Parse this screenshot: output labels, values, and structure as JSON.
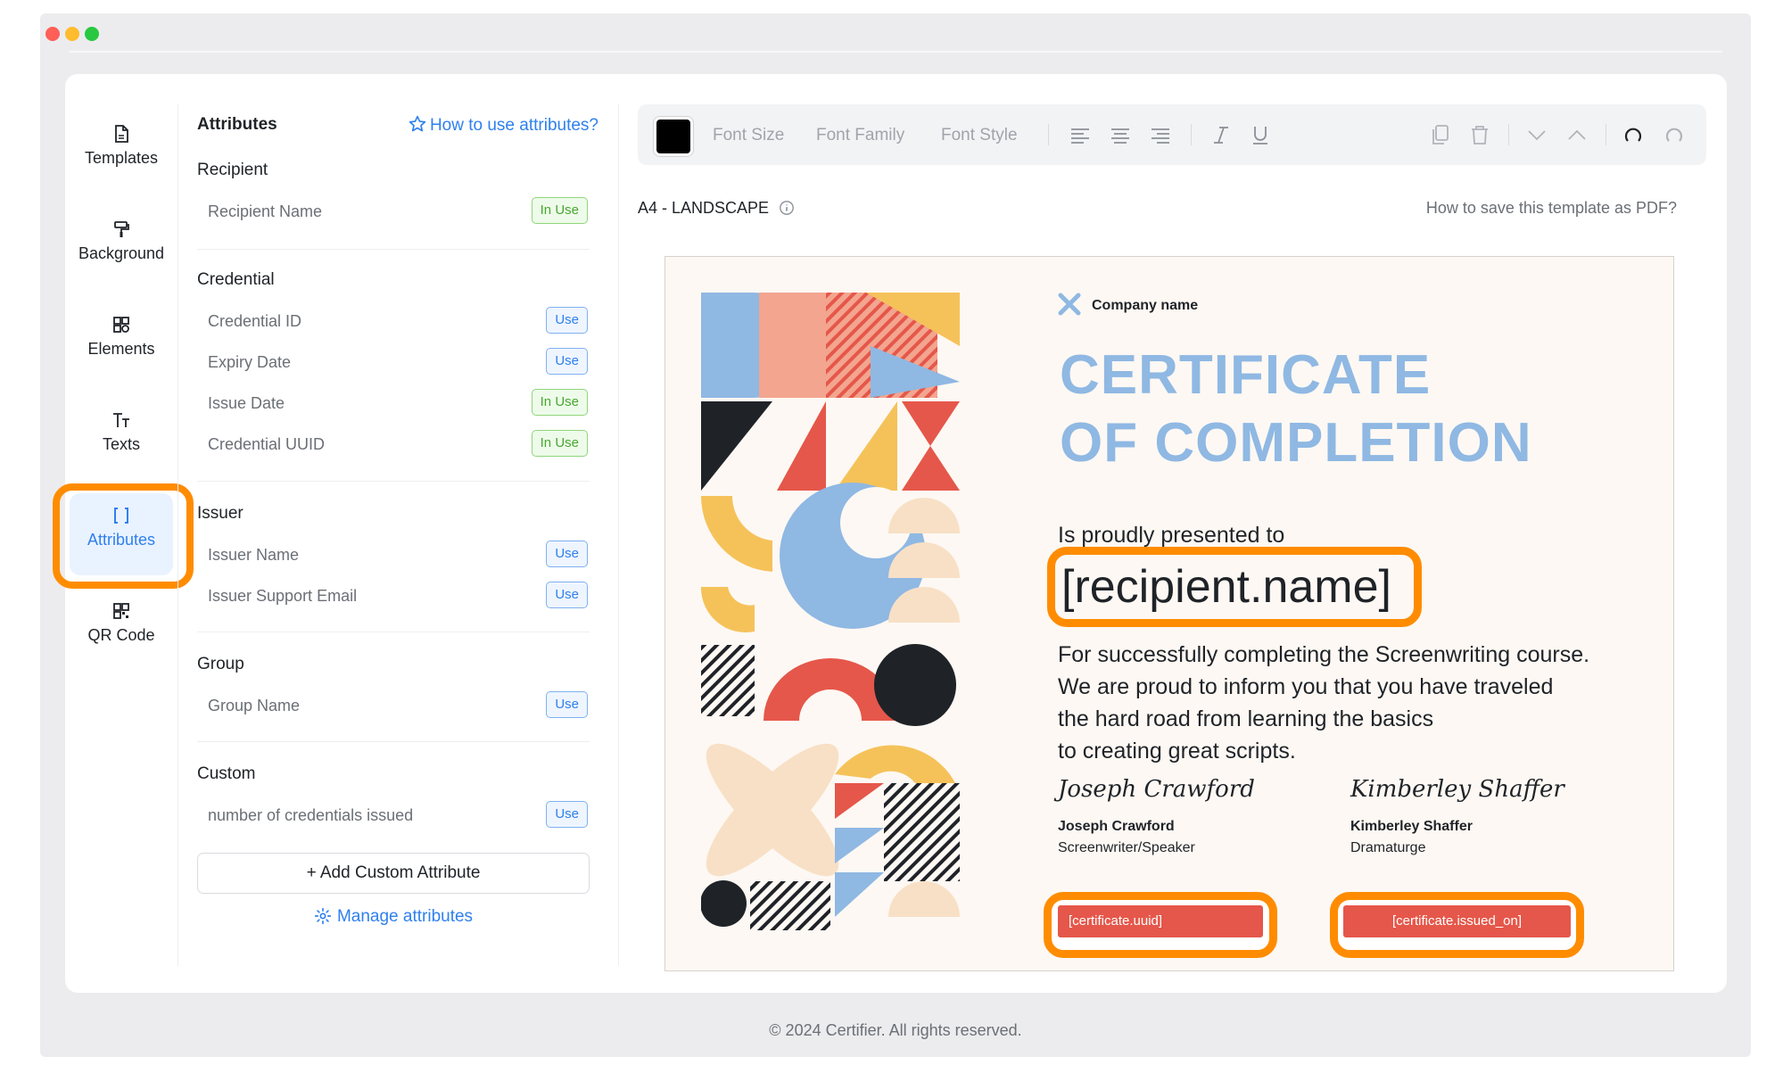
{
  "window": {
    "dots": [
      "#ff5f57",
      "#febc2e",
      "#28c840"
    ]
  },
  "nav": {
    "items": [
      {
        "label": "Templates",
        "icon": "file-icon"
      },
      {
        "label": "Background",
        "icon": "paint-roller-icon"
      },
      {
        "label": "Elements",
        "icon": "shapes-icon"
      },
      {
        "label": "Texts",
        "icon": "text-icon"
      },
      {
        "label": "Attributes",
        "icon": "brackets-icon",
        "active": true
      },
      {
        "label": "QR Code",
        "icon": "qr-code-icon"
      }
    ]
  },
  "attributes": {
    "title": "Attributes",
    "howto": "How to use attributes?",
    "sections": [
      {
        "name": "Recipient",
        "items": [
          {
            "label": "Recipient Name",
            "status": "In Use"
          }
        ]
      },
      {
        "name": "Credential",
        "items": [
          {
            "label": "Credential ID",
            "status": "Use"
          },
          {
            "label": "Expiry Date",
            "status": "Use"
          },
          {
            "label": "Issue Date",
            "status": "In Use"
          },
          {
            "label": "Credential UUID",
            "status": "In Use"
          }
        ]
      },
      {
        "name": "Issuer",
        "items": [
          {
            "label": "Issuer Name",
            "status": "Use"
          },
          {
            "label": "Issuer Support Email",
            "status": "Use"
          }
        ]
      },
      {
        "name": "Group",
        "items": [
          {
            "label": "Group Name",
            "status": "Use"
          }
        ]
      },
      {
        "name": "Custom",
        "items": [
          {
            "label": "number of credentials issued",
            "status": "Use"
          }
        ]
      }
    ],
    "add_button": "+  Add Custom Attribute",
    "manage": "Manage attributes"
  },
  "toolbar": {
    "font_size": "Font Size",
    "font_family": "Font Family",
    "font_style": "Font Style",
    "color": "#000000"
  },
  "canvas": {
    "format": "A4 - LANDSCAPE",
    "save_pdf": "How to save this template as PDF?"
  },
  "certificate": {
    "company": "Company name",
    "title_line1": "CERTIFICATE",
    "title_line2": "OF COMPLETION",
    "presented": "Is proudly presented to",
    "recipient": "[recipient.name]",
    "body": [
      "For successfully completing the Screenwriting course.",
      "We are proud to inform you that you have traveled",
      "the hard road from learning the basics",
      "to creating great scripts."
    ],
    "sig1": {
      "signature": "Joseph Crawford",
      "name": "Joseph Crawford",
      "role": "Screenwriter/Speaker"
    },
    "sig2": {
      "signature": "Kimberley Shaffer",
      "name": "Kimberley Shaffer",
      "role": "Dramaturge"
    },
    "uuid_pill": "[certificate.uuid]",
    "issued_pill": "[certificate.issued_on]"
  },
  "footer": "© 2024 Certifier. All rights reserved."
}
